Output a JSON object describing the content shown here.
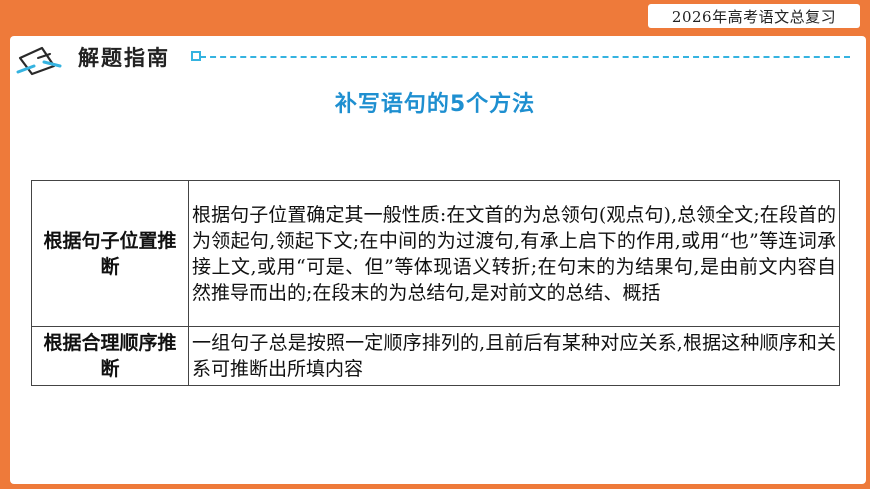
{
  "badge": {
    "text": "2026年高考语文总复习"
  },
  "header": {
    "title": "解题指南"
  },
  "subtitle": "补写语句的5个方法",
  "table": {
    "rows": [
      {
        "label": "根据句子位置推断",
        "content": "根据句子位置确定其一般性质:在文首的为总领句(观点句),总领全文;在段首的为领起句,领起下文;在中间的为过渡句,有承上启下的作用,或用“也”等连词承接上文,或用“可是、但”等体现语义转折;在句末的为结果句,是由前文内容自然推导而出的;在段末的为总结句,是对前文的总结、概括"
      },
      {
        "label": "根据合理顺序推断",
        "content": "一组句子总是按照一定顺序排列的,且前后有某种对应关系,根据这种顺序和关系可推断出所填内容"
      }
    ]
  },
  "colors": {
    "frame": "#ee7a3a",
    "accent": "#35b3e0",
    "subtitle": "#1e8fd0"
  },
  "icons": {
    "header": "notebook-pen-icon"
  }
}
